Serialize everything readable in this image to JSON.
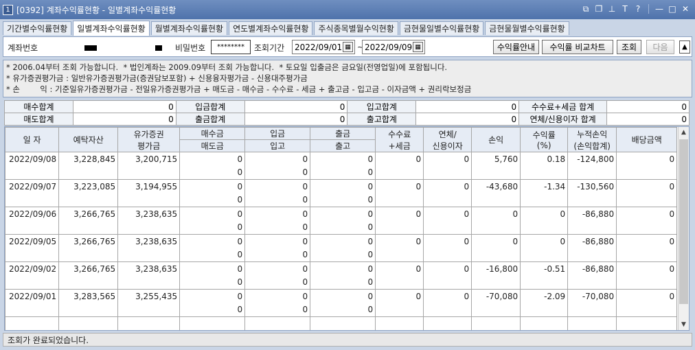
{
  "window": {
    "number": "1",
    "title": "[0392] 계좌수익률현황 - 일별계좌수익률현황"
  },
  "tabs": [
    {
      "label": "기간별수익률현황"
    },
    {
      "label": "일별계좌수익률현황"
    },
    {
      "label": "월별계좌수익률현황"
    },
    {
      "label": "연도별계좌수익률현황"
    },
    {
      "label": "주식종목별월수익현황"
    },
    {
      "label": "금현물일별수익률현황"
    },
    {
      "label": "금현물월별수익률현황"
    }
  ],
  "query": {
    "account_label": "계좌번호",
    "password_label": "비밀번호",
    "password_value": "********",
    "period_label": "조회기간",
    "date_from": "2022/09/01",
    "date_sep": "~",
    "date_to": "2022/09/09",
    "btn_guide": "수익률안내",
    "btn_compare": "수익률 비교차트",
    "btn_search": "조회",
    "btn_next": "다음"
  },
  "notes": [
    "* 2006.04부터 조회 가능합니다.  * 법인계좌는 2009.09부터 조회 가능합니다.  * 토요일 입출금은 금요일(전영업일)에 포함됩니다.",
    "* 유가증권평가금 : 일반유가증권평가금(증권담보포함) + 신용융자평가금 - 신용대주평가금",
    "* 손        익 : 기준일유가증권평가금 - 전일유가증권평가금 + 매도금 - 매수금 - 수수료 - 세금 + 출고금 - 입고금 - 이자금액 + 권리락보정금"
  ],
  "summary": {
    "buy_total_label": "매수합계",
    "buy_total": "0",
    "deposit_total_label": "입금합계",
    "deposit_total": "0",
    "in_total_label": "입고합계",
    "in_total": "0",
    "fee_tax_label": "수수료+세금 합계",
    "fee_tax": "0",
    "sell_total_label": "매도합계",
    "sell_total": "0",
    "withdraw_total_label": "출금합계",
    "withdraw_total": "0",
    "out_total_label": "출고합계",
    "out_total": "0",
    "interest_label": "연체/신용이자 합계",
    "interest": "0"
  },
  "grid": {
    "headers": {
      "date": "일 자",
      "deposit_asset": "예탁자산",
      "sec_eval_1": "유가증권",
      "sec_eval_2": "평가금",
      "buy": "매수금",
      "sell": "매도금",
      "deposit": "입금",
      "in": "입고",
      "withdraw": "출금",
      "out": "출고",
      "fee_1": "수수료",
      "fee_2": "+세금",
      "interest_1": "연체/",
      "interest_2": "신용이자",
      "pnl": "손익",
      "rate_1": "수익률",
      "rate_2": "(%)",
      "cum_1": "누적손익",
      "cum_2": "(손익합계)",
      "dividend": "배당금액"
    },
    "rows": [
      {
        "date": "2022/09/08",
        "asset": "3,228,845",
        "sec": "3,200,715",
        "buy": "0",
        "sell": "0",
        "dep": "0",
        "in": "0",
        "wd": "0",
        "out": "0",
        "fee": "0",
        "int": "0",
        "pnl": "5,760",
        "rate": "0.18",
        "cum": "-124,800",
        "div": "0",
        "pnl_sign": "pos",
        "rate_sign": "pos"
      },
      {
        "date": "2022/09/07",
        "asset": "3,223,085",
        "sec": "3,194,955",
        "buy": "0",
        "sell": "0",
        "dep": "0",
        "in": "0",
        "wd": "0",
        "out": "0",
        "fee": "0",
        "int": "0",
        "pnl": "-43,680",
        "rate": "-1.34",
        "cum": "-130,560",
        "div": "0",
        "pnl_sign": "neg",
        "rate_sign": "neg"
      },
      {
        "date": "2022/09/06",
        "asset": "3,266,765",
        "sec": "3,238,635",
        "buy": "0",
        "sell": "0",
        "dep": "0",
        "in": "0",
        "wd": "0",
        "out": "0",
        "fee": "0",
        "int": "0",
        "pnl": "0",
        "rate": "0",
        "cum": "-86,880",
        "div": "0",
        "pnl_sign": "",
        "rate_sign": ""
      },
      {
        "date": "2022/09/05",
        "asset": "3,266,765",
        "sec": "3,238,635",
        "buy": "0",
        "sell": "0",
        "dep": "0",
        "in": "0",
        "wd": "0",
        "out": "0",
        "fee": "0",
        "int": "0",
        "pnl": "0",
        "rate": "0",
        "cum": "-86,880",
        "div": "0",
        "pnl_sign": "",
        "rate_sign": ""
      },
      {
        "date": "2022/09/02",
        "asset": "3,266,765",
        "sec": "3,238,635",
        "buy": "0",
        "sell": "0",
        "dep": "0",
        "in": "0",
        "wd": "0",
        "out": "0",
        "fee": "0",
        "int": "0",
        "pnl": "-16,800",
        "rate": "-0.51",
        "cum": "-86,880",
        "div": "0",
        "pnl_sign": "neg",
        "rate_sign": "neg"
      },
      {
        "date": "2022/09/01",
        "asset": "3,283,565",
        "sec": "3,255,435",
        "buy": "0",
        "sell": "0",
        "dep": "0",
        "in": "0",
        "wd": "0",
        "out": "0",
        "fee": "0",
        "int": "0",
        "pnl": "-70,080",
        "rate": "-2.09",
        "cum": "-70,080",
        "div": "0",
        "pnl_sign": "neg",
        "rate_sign": "neg"
      }
    ]
  },
  "status": "조회가 완료되었습니다.",
  "colors": {
    "positive": "#c0392b",
    "negative": "#1a5a8c",
    "titlebar": "#4f73ab"
  }
}
